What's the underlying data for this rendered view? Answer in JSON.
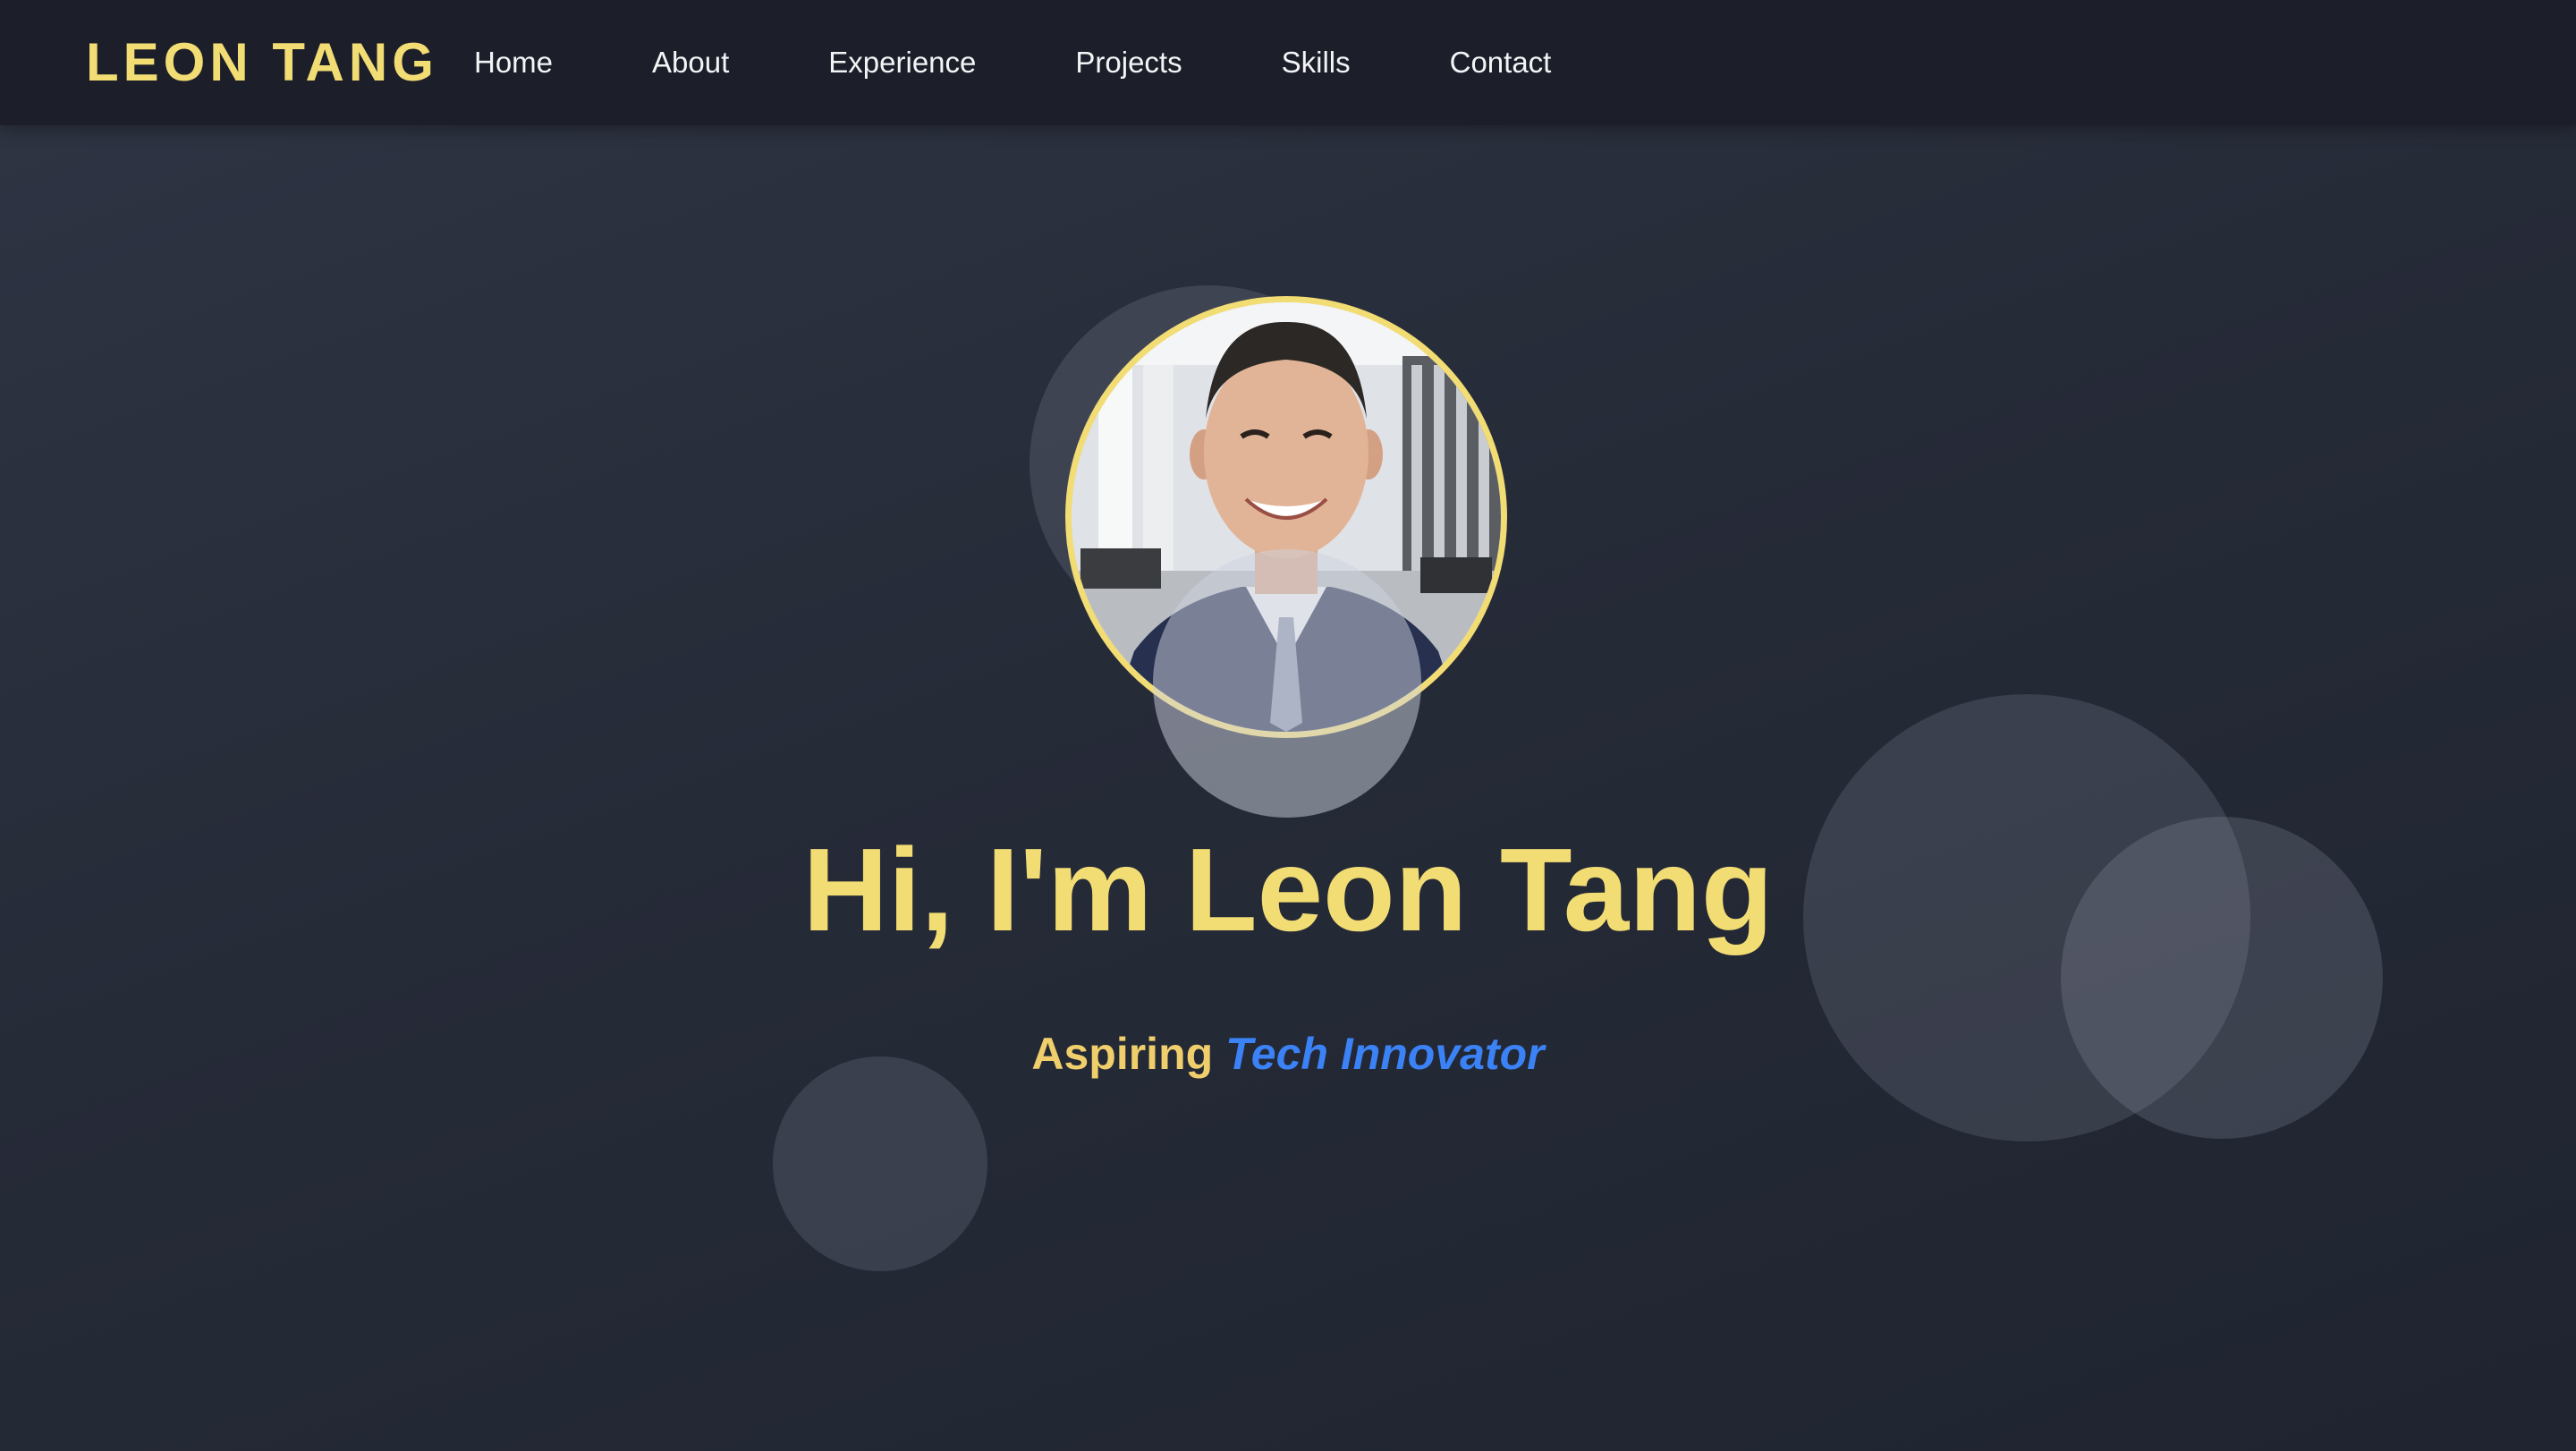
{
  "brand": {
    "name": "LEON TANG"
  },
  "nav": {
    "links": [
      {
        "label": "Home"
      },
      {
        "label": "About"
      },
      {
        "label": "Experience"
      },
      {
        "label": "Projects"
      },
      {
        "label": "Skills"
      },
      {
        "label": "Contact"
      }
    ]
  },
  "hero": {
    "title": "Hi, I'm Leon Tang",
    "subtitle_prefix": "Aspiring",
    "subtitle_highlight": "Tech Innovator"
  },
  "colors": {
    "accent_yellow": "#f2dc74",
    "accent_blue": "#3b82f6",
    "nav_background": "#1c1f29",
    "page_background": "#282d3a"
  }
}
